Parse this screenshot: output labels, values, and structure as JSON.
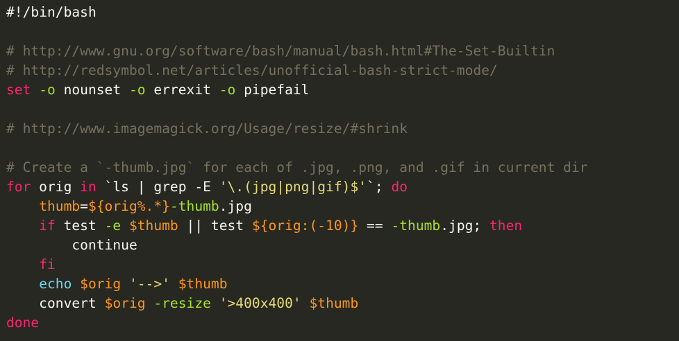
{
  "file": {
    "language": "bash",
    "lines": [
      [
        {
          "t": "#!/bin/bash",
          "c": "plain"
        }
      ],
      [],
      [
        {
          "t": "# http://www.gnu.org/software/bash/manual/bash.html#The-Set-Builtin",
          "c": "comment"
        }
      ],
      [
        {
          "t": "# http://redsymbol.net/articles/unofficial-bash-strict-mode/",
          "c": "comment"
        }
      ],
      [
        {
          "t": "set",
          "c": "keyword"
        },
        {
          "t": " ",
          "c": "plain"
        },
        {
          "t": "-o",
          "c": "flag"
        },
        {
          "t": " nounset ",
          "c": "plain"
        },
        {
          "t": "-o",
          "c": "flag"
        },
        {
          "t": " errexit ",
          "c": "plain"
        },
        {
          "t": "-o",
          "c": "flag"
        },
        {
          "t": " pipefail",
          "c": "plain"
        }
      ],
      [],
      [
        {
          "t": "# http://www.imagemagick.org/Usage/resize/#shrink",
          "c": "comment"
        }
      ],
      [],
      [
        {
          "t": "# Create a `-thumb.jpg` for each of .jpg, .png, and .gif in current dir",
          "c": "comment"
        }
      ],
      [
        {
          "t": "for",
          "c": "keyword"
        },
        {
          "t": " orig ",
          "c": "plain"
        },
        {
          "t": "in",
          "c": "keyword"
        },
        {
          "t": " `ls | grep -E ",
          "c": "plain"
        },
        {
          "t": "'\\.(jpg|png|gif)$'",
          "c": "string"
        },
        {
          "t": "`; ",
          "c": "plain"
        },
        {
          "t": "do",
          "c": "keyword"
        }
      ],
      [
        {
          "t": "    ",
          "c": "plain"
        },
        {
          "t": "thumb",
          "c": "variable"
        },
        {
          "t": "=",
          "c": "plain"
        },
        {
          "t": "${orig%.*}",
          "c": "variable"
        },
        {
          "t": "-thumb",
          "c": "flag"
        },
        {
          "t": ".jpg",
          "c": "plain"
        }
      ],
      [
        {
          "t": "    ",
          "c": "plain"
        },
        {
          "t": "if",
          "c": "keyword"
        },
        {
          "t": " test ",
          "c": "plain"
        },
        {
          "t": "-e",
          "c": "flag"
        },
        {
          "t": " ",
          "c": "plain"
        },
        {
          "t": "$thumb",
          "c": "variable"
        },
        {
          "t": " || test ",
          "c": "plain"
        },
        {
          "t": "${orig:(-10)}",
          "c": "variable"
        },
        {
          "t": " == ",
          "c": "plain"
        },
        {
          "t": "-thumb",
          "c": "flag"
        },
        {
          "t": ".jpg; ",
          "c": "plain"
        },
        {
          "t": "then",
          "c": "keyword"
        }
      ],
      [
        {
          "t": "        continue",
          "c": "plain"
        }
      ],
      [
        {
          "t": "    ",
          "c": "plain"
        },
        {
          "t": "fi",
          "c": "keyword"
        }
      ],
      [
        {
          "t": "    ",
          "c": "plain"
        },
        {
          "t": "echo",
          "c": "builtin"
        },
        {
          "t": " ",
          "c": "plain"
        },
        {
          "t": "$orig",
          "c": "variable"
        },
        {
          "t": " ",
          "c": "plain"
        },
        {
          "t": "'-->'",
          "c": "string"
        },
        {
          "t": " ",
          "c": "plain"
        },
        {
          "t": "$thumb",
          "c": "variable"
        }
      ],
      [
        {
          "t": "    convert ",
          "c": "plain"
        },
        {
          "t": "$orig",
          "c": "variable"
        },
        {
          "t": " ",
          "c": "plain"
        },
        {
          "t": "-resize",
          "c": "flag"
        },
        {
          "t": " ",
          "c": "plain"
        },
        {
          "t": "'>400x400'",
          "c": "string"
        },
        {
          "t": " ",
          "c": "plain"
        },
        {
          "t": "$thumb",
          "c": "variable"
        }
      ],
      [
        {
          "t": "done",
          "c": "keyword"
        }
      ]
    ]
  },
  "theme": {
    "background": "#272822",
    "plain": "#f8f8f2",
    "comment": "#75715e",
    "keyword": "#f92672",
    "builtin": "#66d9ef",
    "flag": "#a6e22e",
    "variable": "#fd971f",
    "string": "#e6db74"
  }
}
